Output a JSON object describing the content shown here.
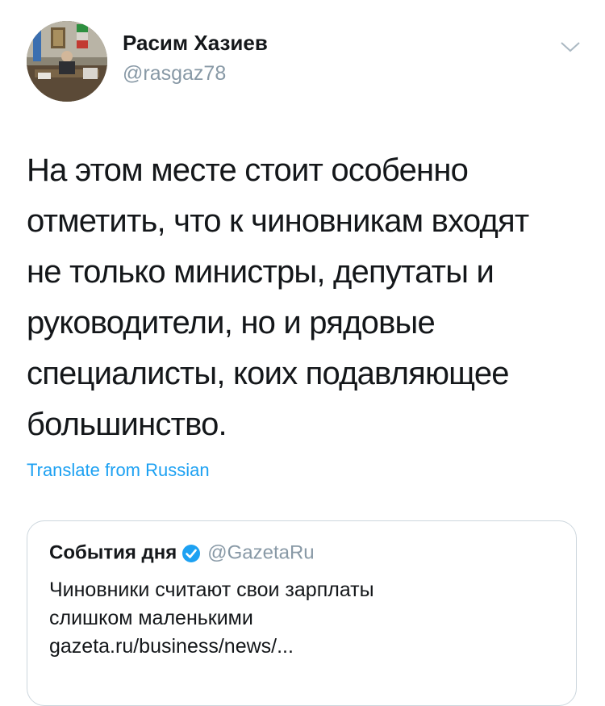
{
  "author": {
    "name": "Расим Хазиев",
    "handle": "@rasgaz78",
    "avatar": "profile-photo"
  },
  "tweet": {
    "text_lines": [
      "На этом месте стоит особенно",
      "отметить, что к чиновникам входят",
      "не только министры, депутаты и",
      "руководители, но и рядовые",
      "специалисты, коих подавляющее",
      "большинство."
    ],
    "translate_label": "Translate from Russian"
  },
  "quoted_tweet": {
    "name": "События дня",
    "handle": "@GazetaRu",
    "verified": true,
    "body_lines": [
      "Чиновники считают свои зарплаты",
      "слишком маленькими",
      "gazeta.ru/business/news/..."
    ]
  },
  "icons": {
    "menu": "chevron-down-icon",
    "verified": "verified-badge-icon"
  },
  "colors": {
    "text": "#14171a",
    "secondary": "#8899a6",
    "link": "#1da1f2",
    "border": "#ccd6dd"
  }
}
